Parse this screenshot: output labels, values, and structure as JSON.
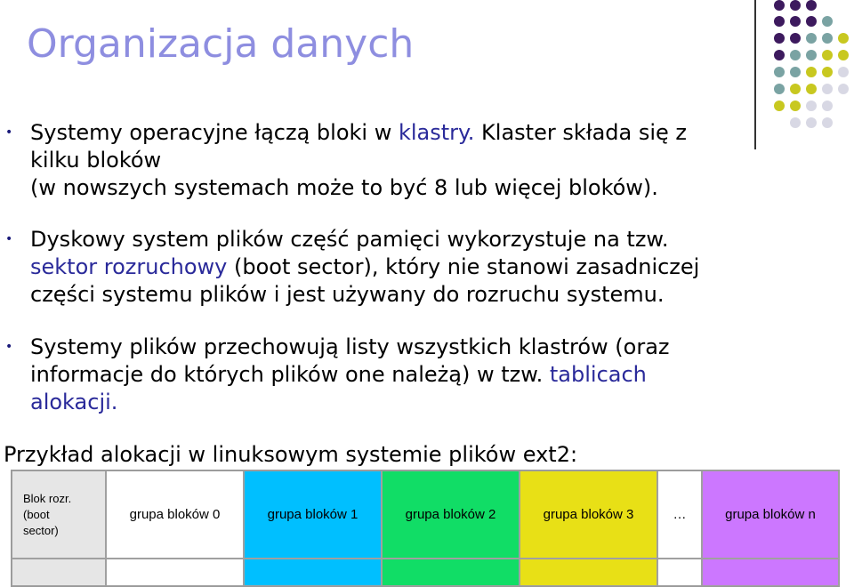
{
  "slide": {
    "title": "Organizacja danych",
    "bullets": [
      {
        "parts": [
          {
            "text": "Systemy operacyjne łączą bloki w ",
            "highlight": false
          },
          {
            "text": "klastry.",
            "highlight": true
          },
          {
            "text": " Klaster składa się z kilku bloków (w nowszych systemach może to być 8 lub więcej bloków).",
            "highlight": false
          }
        ],
        "line1a": "Systemy operacyjne łączą bloki w ",
        "line1b": "klastry.",
        "line1c": " Klaster składa się z",
        "line2": "kilku bloków",
        "line3": "(w nowszych systemach może to być 8 lub więcej bloków)."
      },
      {
        "line1": "Dyskowy system plików część pamięci wykorzystuje na tzw.",
        "line2a": "sektor rozruchowy",
        "line2b": " (boot sector), który nie stanowi zasadniczej",
        "line3": "części systemu plików i jest używany do rozruchu systemu."
      },
      {
        "line1": "Systemy plików przechowują listy wszystkich klastrów (oraz",
        "line2a": "informacje do których plików one należą) w tzw. ",
        "line2b": "tablicach",
        "line3": "alokacji."
      }
    ],
    "example_heading": "Przykład alokacji w linuksowym systemie plików ext2:",
    "table": {
      "cells": [
        {
          "label_line1": "Blok rozr.",
          "label_line2": "(boot",
          "label_line3": "sector)",
          "color": "#e6e6e6"
        },
        {
          "label": "grupa bloków 0",
          "color": "#ffffff"
        },
        {
          "label": "grupa bloków 1",
          "color": "#00bfff"
        },
        {
          "label": "grupa bloków 2",
          "color": "#11dd66"
        },
        {
          "label": "grupa bloków 3",
          "color": "#e8e016"
        },
        {
          "label": "…",
          "color": "#ffffff"
        },
        {
          "label": "grupa bloków n",
          "color": "#cc77ff"
        }
      ]
    },
    "colors": {
      "title": "#8e8ee0",
      "highlight": "#2a2a9a",
      "dot_purple": "#3d1a5e",
      "dot_teal": "#7aa3a3",
      "dot_yellow": "#c8c820",
      "dot_gray": "#d8d8e4"
    }
  }
}
